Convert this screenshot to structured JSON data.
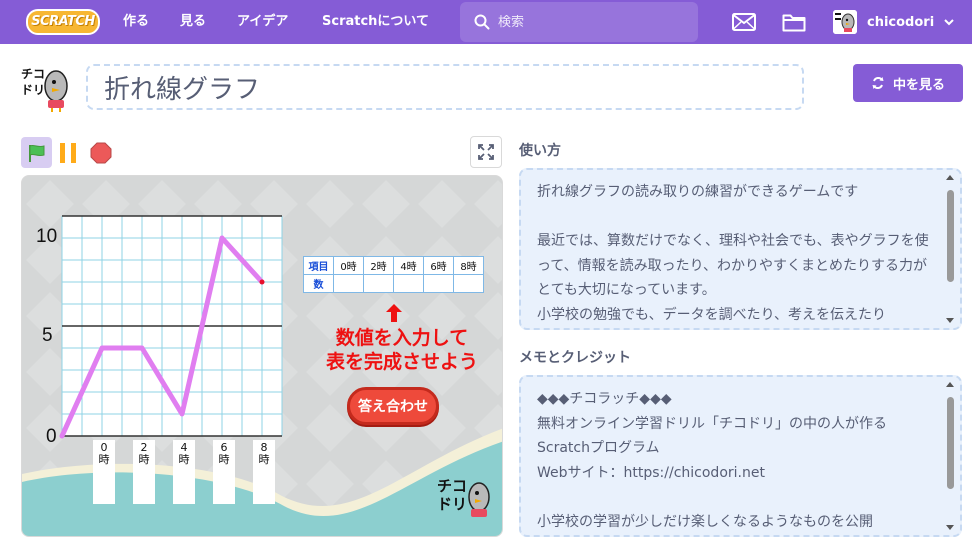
{
  "nav": {
    "logo": "SCRATCH",
    "items": [
      "作る",
      "見る",
      "アイデア",
      "Scratchについて"
    ],
    "search_placeholder": "検索",
    "username": "chicodori"
  },
  "project": {
    "title": "折れ線グラフ",
    "see_inside": "中を見る",
    "avatar_text": "チコドリ"
  },
  "stage": {
    "y_ticks": [
      "10",
      "5",
      "0"
    ],
    "x_labels": [
      {
        "num": "0",
        "unit": "時"
      },
      {
        "num": "2",
        "unit": "時"
      },
      {
        "num": "4",
        "unit": "時"
      },
      {
        "num": "6",
        "unit": "時"
      },
      {
        "num": "8",
        "unit": "時"
      }
    ],
    "table": {
      "row1_head": "項目",
      "row2_head": "数",
      "columns": [
        "0時",
        "2時",
        "4時",
        "6時",
        "8時"
      ]
    },
    "instruction_line1": "数値を入力して",
    "instruction_line2": "表を完成させよう",
    "check_button": "答え合わせ",
    "logo_text": "チコドリ",
    "line_color": "#e07ef0"
  },
  "chart_data": {
    "type": "line",
    "x": [
      0,
      2,
      4,
      6,
      8
    ],
    "values": [
      0,
      4,
      4,
      1,
      9,
      7
    ],
    "points": [
      [
        0,
        0
      ],
      [
        1,
        4
      ],
      [
        2,
        4
      ],
      [
        3,
        1
      ],
      [
        4,
        9
      ],
      [
        5,
        7
      ]
    ],
    "ylim": [
      0,
      10
    ],
    "y_ticks": [
      0,
      5,
      10
    ],
    "grid": true
  },
  "instructions": {
    "title": "使い方",
    "text": "折れ線グラフの読み取りの練習ができるゲームです\n\n最近では、算数だけでなく、理科や社会でも、表やグラフを使って、情報を読み取ったり、わかりやすくまとめたりする力がとても大切になっています。\n小学校の勉強でも、データを調べたり、考えを伝えたり"
  },
  "notes": {
    "title": "メモとクレジット",
    "text": "◆◆◆チコラッチ◆◆◆\n無料オンライン学習ドリル「チコドリ」の中の人が作るScratchプログラム\nWebサイト：https://chicodori.net\n\n小学校の学習が少しだけ楽しくなるようなものを公開"
  }
}
